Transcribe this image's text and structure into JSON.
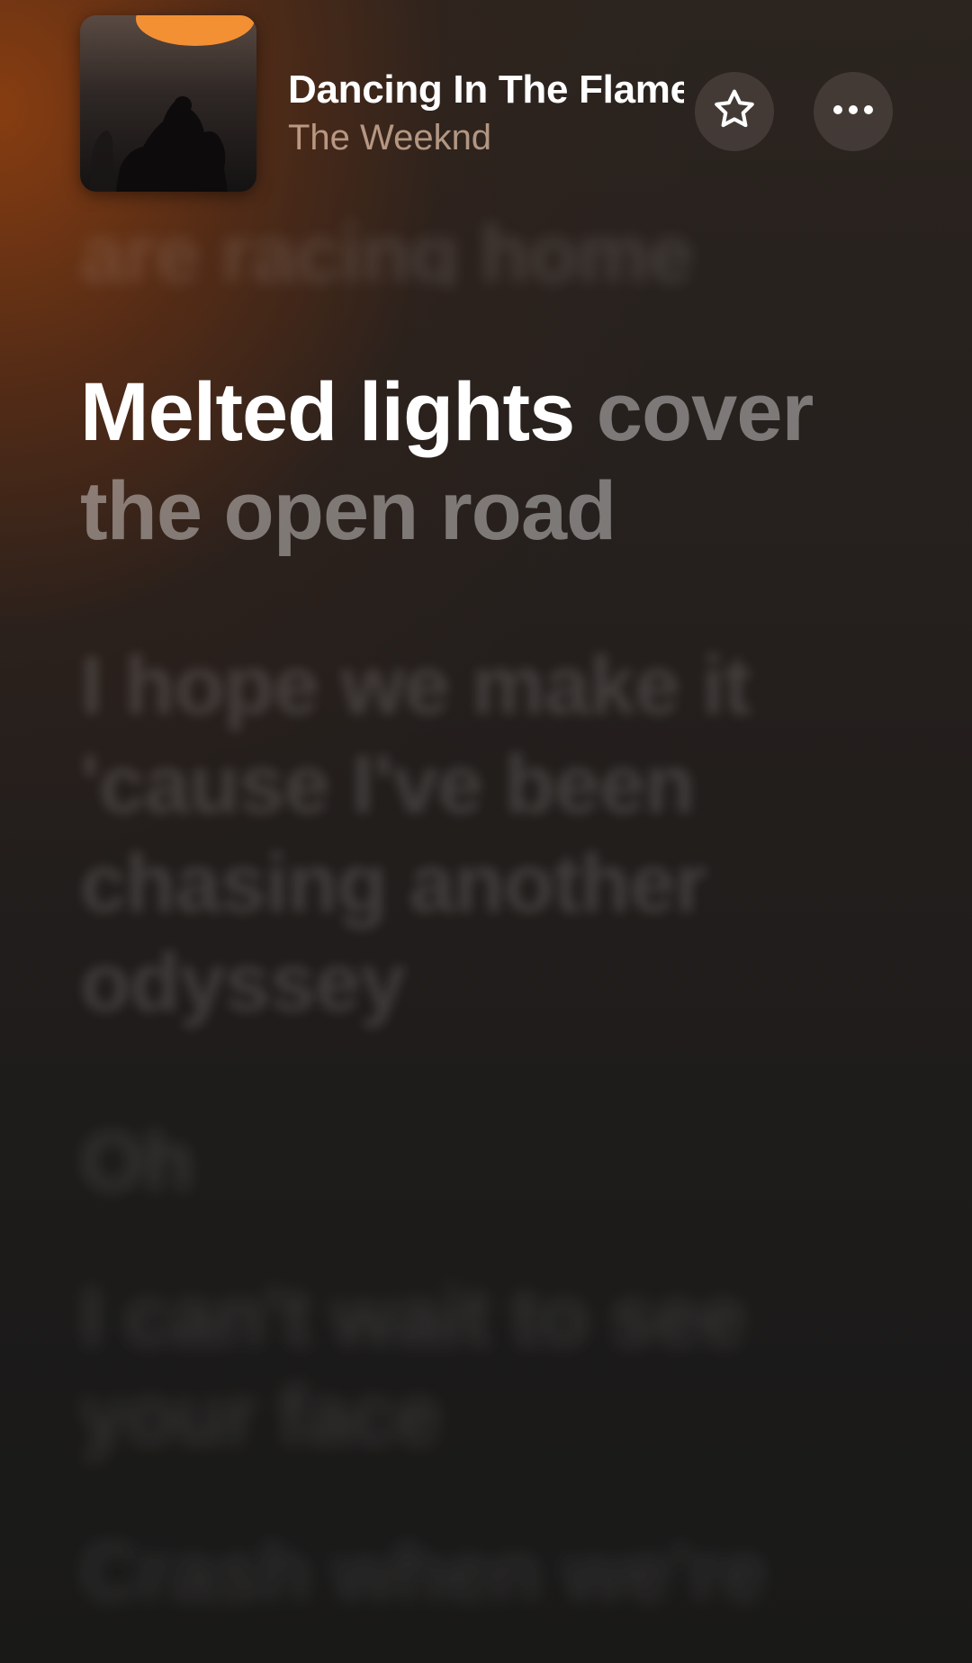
{
  "now_playing": {
    "title": "Dancing In The Flames",
    "artist": "The Weeknd",
    "artwork": "album-artwork"
  },
  "header_buttons": {
    "favorite_icon": "star-outline-icon",
    "more_icon": "ellipsis-icon"
  },
  "lyrics": {
    "previous_line": "are racing home",
    "current_line_sung": "Melted lights",
    "current_line_unsung": " cover the open road",
    "upcoming": [
      "I hope we make it 'cause I've been chasing another odyssey",
      "Oh",
      "I can't wait to see your face",
      "Crash when we're"
    ]
  },
  "colors": {
    "accent_glow": "#8c3e10",
    "background": "#1c1a19",
    "title_text": "#ffffff",
    "artist_text": "#e6c4aa"
  }
}
